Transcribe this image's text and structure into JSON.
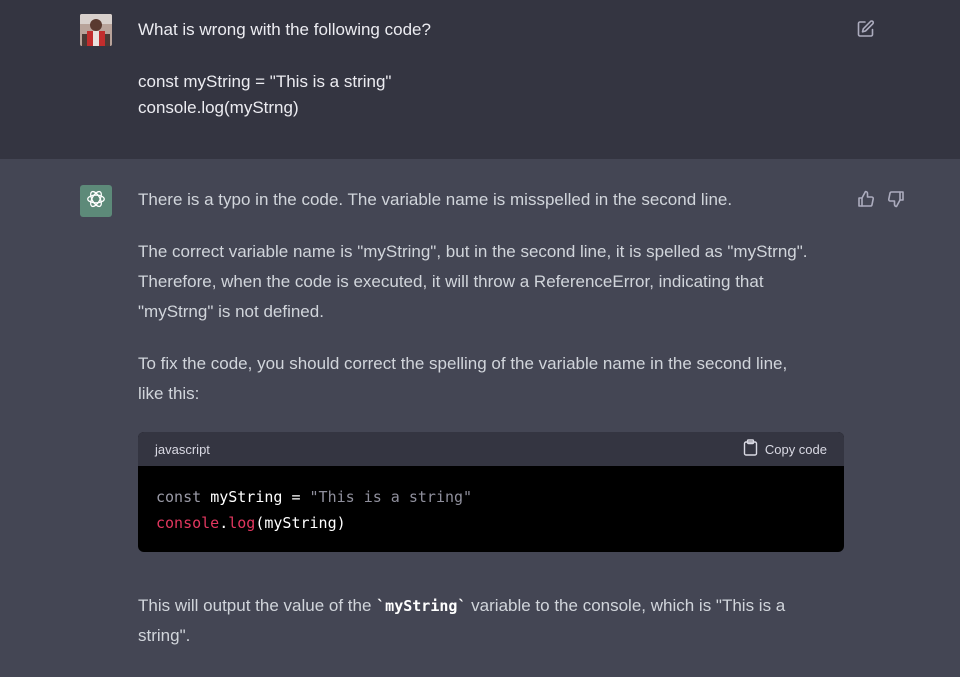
{
  "user_message": {
    "lines": [
      "What is wrong with the following code?",
      "",
      "const myString = \"This is a string\"",
      "console.log(myStrng)"
    ]
  },
  "assistant_message": {
    "paragraphs": {
      "p1": [
        "There is a typo in the code. The variable name is misspelled in the second line."
      ],
      "p2": [
        "The correct variable name is \"myString\", but in the second line, it is spelled as \"myStrng\".",
        "Therefore, when the code is executed, it will throw a ReferenceError, indicating that",
        "\"myStrng\" is not defined."
      ],
      "p3": [
        "To fix the code, you should correct the spelling of the variable name in the second line,",
        "like this:"
      ],
      "p4_prefix": "This will output the value of the ",
      "p4_code": "`myString`",
      "p4_suffix": " variable to the console, which is \"This is a",
      "p4_line2": "string\"."
    },
    "code_block": {
      "language": "javascript",
      "copy_label": "Copy code",
      "line1": {
        "keyword": "const",
        "identifier": "myString",
        "operator": "=",
        "string": "\"This is a string\""
      },
      "line2": {
        "object": "console",
        "dot": ".",
        "method": "log",
        "args": "(myString)"
      }
    }
  },
  "icons": {
    "edit": "edit-icon",
    "thumbs_up": "thumbs-up-icon",
    "thumbs_down": "thumbs-down-icon",
    "copy": "clipboard-icon",
    "assistant_logo": "openai-logo-icon"
  },
  "colors": {
    "user_bg": "#343541",
    "assistant_bg": "#444654",
    "code_header_bg": "#343541",
    "code_bg": "#000000",
    "assistant_avatar": "#5d8a79",
    "code_accent": "#e2375f"
  }
}
